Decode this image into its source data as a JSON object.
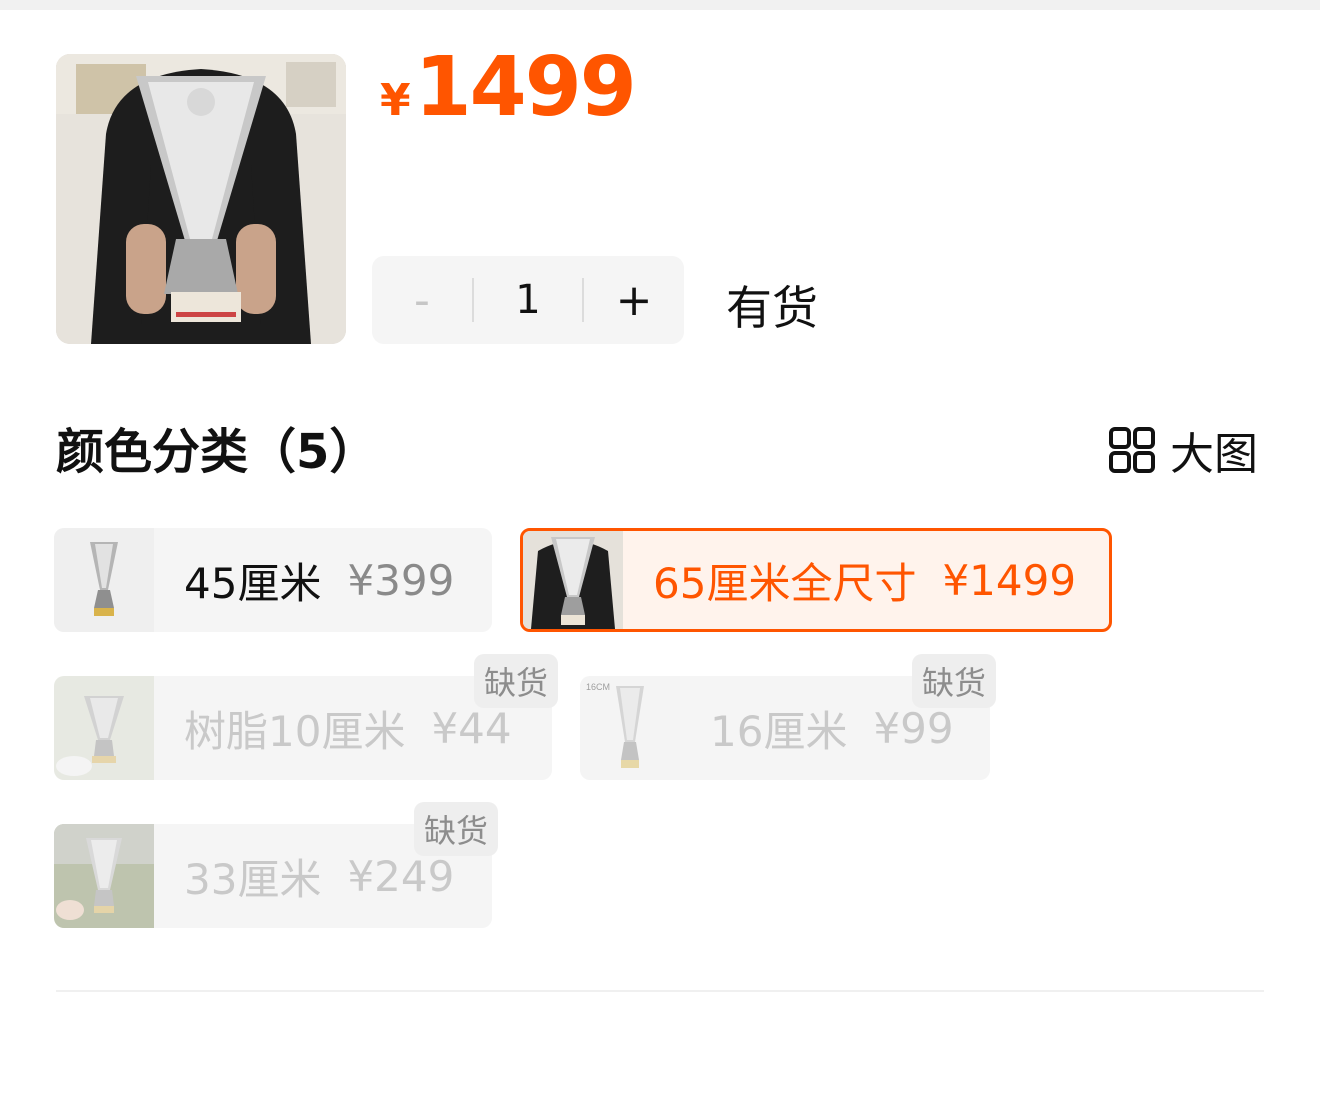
{
  "product": {
    "price_symbol": "¥",
    "price_value": "1499",
    "image_icon": "trophy-photo-icon"
  },
  "quantity": {
    "minus_label": "-",
    "value": "1",
    "plus_label": "+",
    "stock_text": "有货"
  },
  "section": {
    "title": "颜色分类（5）",
    "big_image_label": "大图",
    "big_image_icon": "grid-icon"
  },
  "options": [
    {
      "name": "45厘米",
      "price": "¥399",
      "badge": "",
      "state": "normal"
    },
    {
      "name": "65厘米全尺寸",
      "price": "¥1499",
      "badge": "",
      "state": "selected"
    },
    {
      "name": "树脂10厘米",
      "price": "¥44",
      "badge": "缺货",
      "state": "disabled"
    },
    {
      "name": "16厘米",
      "price": "¥99",
      "badge": "缺货",
      "state": "disabled"
    },
    {
      "name": "33厘米",
      "price": "¥249",
      "badge": "缺货",
      "state": "disabled"
    }
  ],
  "thumb_label_16cm": "16CM",
  "colors": {
    "accent": "#ff5500",
    "option_bg": "#f5f5f5",
    "selected_bg": "#fff3ec",
    "disabled_text": "#c9c9c9"
  }
}
